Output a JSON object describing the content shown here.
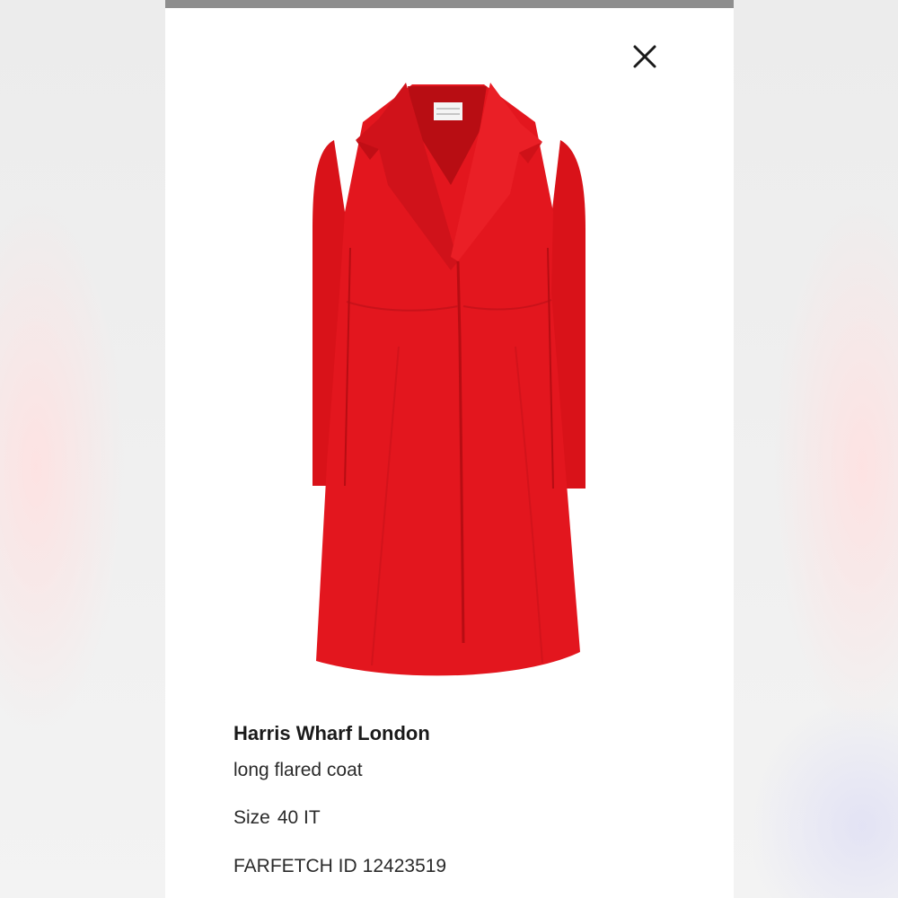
{
  "product": {
    "brand": "Harris Wharf London",
    "name": "long flared coat",
    "size_label": "Size",
    "size_value": "40 IT",
    "id_label": "FARFETCH ID",
    "id_value": "12423519"
  },
  "colors": {
    "coat_red": "#e3161e",
    "accent_grey": "#8e8e8e"
  },
  "icons": {
    "close": "close-icon"
  }
}
